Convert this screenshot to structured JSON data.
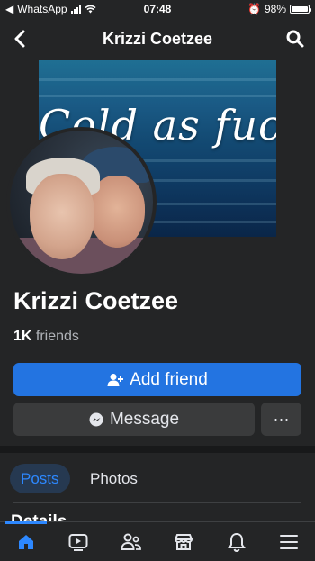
{
  "status_bar": {
    "carrier": "WhatsApp",
    "time": "07:48",
    "battery_percent": "98%",
    "battery_level": 0.98
  },
  "header": {
    "title": "Krizzi Coetzee",
    "back_icon": "chevron-left-icon",
    "search_icon": "search-icon"
  },
  "cover": {
    "text": "Cold as fuck"
  },
  "profile": {
    "name": "Krizzi Coetzee",
    "friend_count": "1K",
    "friends_label": "friends"
  },
  "actions": {
    "add_friend_label": "Add friend",
    "message_label": "Message",
    "more_label": "···"
  },
  "tabs": [
    {
      "label": "Posts",
      "active": true
    },
    {
      "label": "Photos",
      "active": false
    }
  ],
  "section": {
    "details_heading": "Details"
  },
  "bottom_nav": [
    {
      "icon": "home-icon",
      "active": true
    },
    {
      "icon": "watch-icon",
      "active": false
    },
    {
      "icon": "friends-icon",
      "active": false
    },
    {
      "icon": "marketplace-icon",
      "active": false
    },
    {
      "icon": "bell-icon",
      "active": false
    },
    {
      "icon": "menu-icon",
      "active": false
    }
  ],
  "colors": {
    "accent": "#2374e1",
    "active_tab_text": "#2d88ff",
    "background": "#18191a",
    "surface": "#242526"
  }
}
